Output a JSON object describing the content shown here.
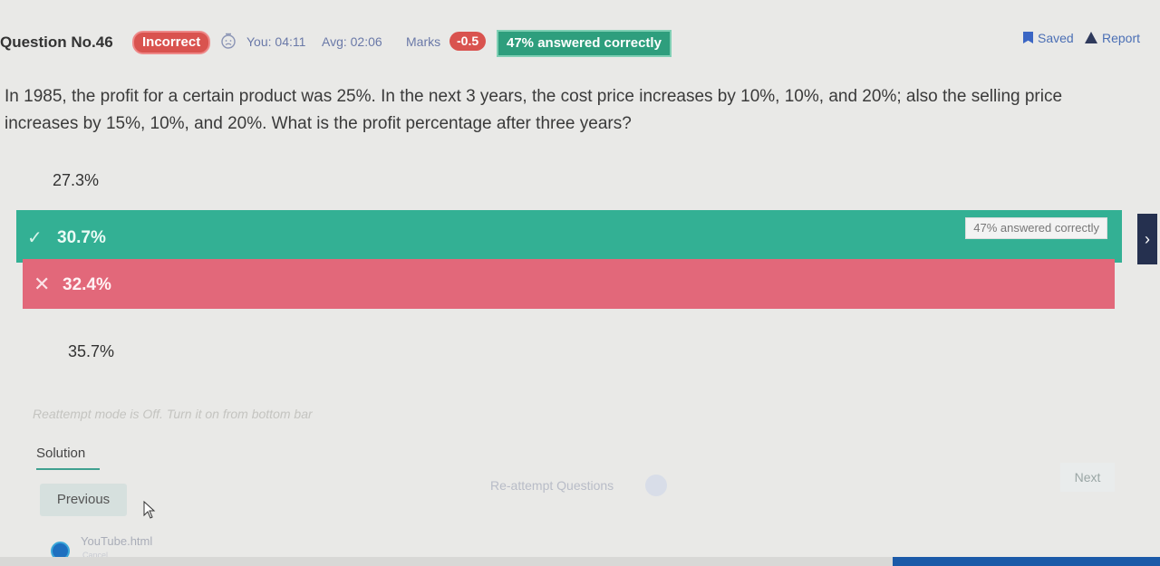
{
  "header": {
    "question_no": "Question No.46",
    "status": "Incorrect",
    "you_time": "You: 04:11",
    "avg_time": "Avg: 02:06",
    "marks_label": "Marks",
    "marks_value": "-0.5",
    "pct_correct": "47% answered correctly",
    "saved_label": "Saved",
    "report_label": "Report"
  },
  "question": {
    "text": "In 1985, the profit for a certain product was 25%. In the next 3 years, the cost price increases by 10%, 10%, and 20%; also the selling price increases by 15%, 10%, and 20%. What is the profit percentage after three years?"
  },
  "options": [
    {
      "label": "27.3%",
      "state": "none"
    },
    {
      "label": "30.7%",
      "state": "correct",
      "pct": "47% answered correctly"
    },
    {
      "label": "32.4%",
      "state": "incorrect"
    },
    {
      "label": "35.7%",
      "state": "none"
    }
  ],
  "reattempt_note": "Reattempt mode is Off. Turn it on from bottom bar",
  "solution_tab": "Solution",
  "footer": {
    "reattempt_label": "Re-attempt Questions",
    "next_label": "Next",
    "previous_label": "Previous"
  },
  "taskbar": {
    "file_label": "YouTube.html",
    "file_sub": "Cancel"
  },
  "colors": {
    "correct": "#33b094",
    "incorrect": "#e2687a",
    "badge_red": "#d9534f",
    "link_blue": "#4b6fb5"
  }
}
